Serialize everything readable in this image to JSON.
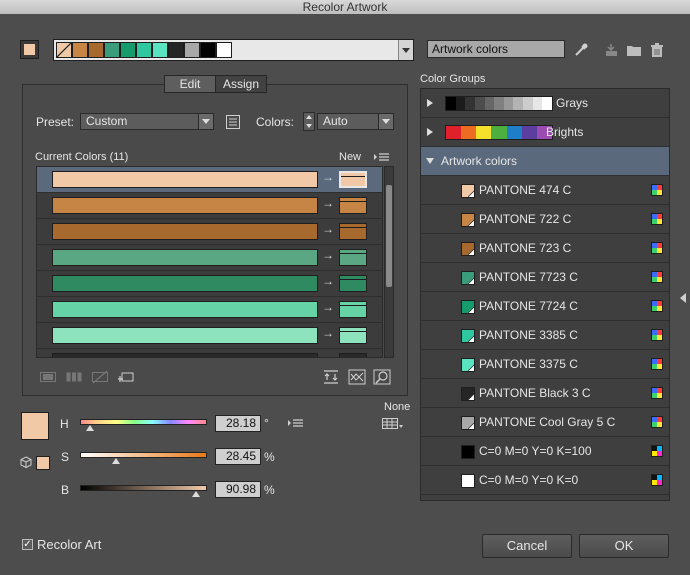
{
  "window": {
    "title": "Recolor Artwork"
  },
  "header": {
    "active_color": "#f2c9a7",
    "harmony_swatches": [
      "#f2c9a7",
      "#c78545",
      "#a8692e",
      "#3a9c7a",
      "#169c6c",
      "#2fc7a0",
      "#59e3c0",
      "#252525",
      "#a8a8a8",
      "#000000",
      "#ffffff"
    ],
    "group_name": "Artwork colors"
  },
  "tabs": {
    "edit": "Edit",
    "assign": "Assign"
  },
  "edit": {
    "preset_label": "Preset:",
    "preset_value": "Custom",
    "colors_label": "Colors:",
    "colors_value": "Auto",
    "current_colors_label": "Current Colors (11)",
    "new_label": "New",
    "rows": [
      {
        "current": "#f2c9a7",
        "new": "#f2c9a7",
        "selected": true
      },
      {
        "current": "#c78545",
        "new": "#c78545"
      },
      {
        "current": "#a8692e",
        "new": "#a8692e"
      },
      {
        "current": "#5aa883",
        "new": "#5aa883"
      },
      {
        "current": "#2f8a62",
        "new": "#2f8a62"
      },
      {
        "current": "#66d3a6",
        "new": "#66d3a6"
      },
      {
        "current": "#8ce3be",
        "new": "#8ce3be"
      },
      {
        "current": "#2a2a2a",
        "new": "#2a2a2a"
      }
    ]
  },
  "hsb": {
    "swatch": "#f2c9a7",
    "h_label": "H",
    "s_label": "S",
    "b_label": "B",
    "h_value": "28.18",
    "h_unit": "°",
    "s_value": "28.45",
    "s_unit": "%",
    "b_value": "90.98",
    "b_unit": "%",
    "h_fraction": 0.08,
    "s_fraction": 0.28,
    "b_fraction": 0.91,
    "none_label": "None"
  },
  "color_groups": {
    "title": "Color Groups",
    "grays": {
      "name": "Grays",
      "colors": [
        "#000000",
        "#1c1c1c",
        "#333333",
        "#4d4d4d",
        "#666666",
        "#808080",
        "#999999",
        "#b3b3b3",
        "#cccccc",
        "#e6e6e6",
        "#ffffff"
      ]
    },
    "brights": {
      "name": "Brights",
      "colors": [
        "#e0202a",
        "#ee6c22",
        "#f5e12b",
        "#4caf3f",
        "#1e7fc8",
        "#5a3ea0",
        "#9a4cb0"
      ]
    },
    "artwork": {
      "name": "Artwork colors",
      "items": [
        {
          "name": "PANTONE 474 C",
          "color": "#f2c9a7",
          "spot": true
        },
        {
          "name": "PANTONE 722 C",
          "color": "#c78545",
          "spot": true
        },
        {
          "name": "PANTONE 723 C",
          "color": "#a8692e",
          "spot": true
        },
        {
          "name": "PANTONE 7723 C",
          "color": "#3a9c7a",
          "spot": true
        },
        {
          "name": "PANTONE 7724 C",
          "color": "#169c6c",
          "spot": true
        },
        {
          "name": "PANTONE 3385 C",
          "color": "#2fc7a0",
          "spot": true
        },
        {
          "name": "PANTONE 3375 C",
          "color": "#59e3c0",
          "spot": true
        },
        {
          "name": "PANTONE Black 3 C",
          "color": "#252525",
          "spot": true
        },
        {
          "name": "PANTONE Cool Gray 5 C",
          "color": "#a8a8a8",
          "spot": true
        },
        {
          "name": "C=0 M=0 Y=0 K=100",
          "color": "#000000",
          "spot": false
        },
        {
          "name": "C=0 M=0 Y=0 K=0",
          "color": "#ffffff",
          "spot": false
        }
      ]
    }
  },
  "footer": {
    "recolor_art_label": "Recolor Art",
    "recolor_art_checked": true,
    "cancel_label": "Cancel",
    "ok_label": "OK"
  }
}
